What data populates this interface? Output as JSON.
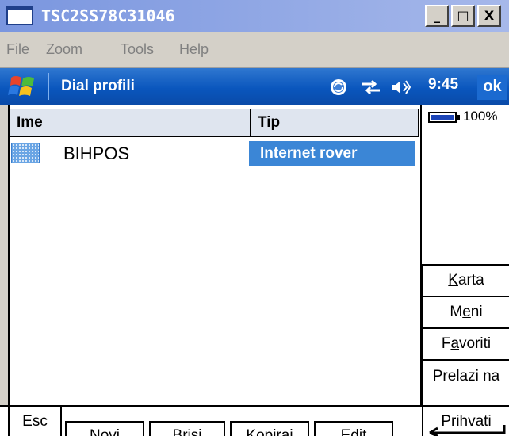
{
  "window": {
    "title": "TSC2SS78C31046",
    "controls": {
      "minimize": "_",
      "maximize": "□",
      "close": "X"
    }
  },
  "menubar": {
    "items": [
      {
        "first": "F",
        "rest": "ile"
      },
      {
        "first": "Z",
        "rest": "oom"
      },
      {
        "first": "T",
        "rest": "ools"
      },
      {
        "first": "H",
        "rest": "elp"
      }
    ]
  },
  "device_titlebar": {
    "title": "Dial profili",
    "time": "9:45",
    "ok_label": "ok",
    "icons": [
      "windows-start-icon",
      "sync-icon",
      "connectivity-icon",
      "speaker-icon"
    ]
  },
  "list": {
    "columns": [
      "Ime",
      "Tip"
    ],
    "rows": [
      {
        "name": "BIHPOS",
        "type": "Internet rover",
        "selected": true
      }
    ]
  },
  "status": {
    "battery_percent": "100%",
    "battery_level": 1.0
  },
  "side_menu": [
    {
      "pre": "",
      "ul": "K",
      "post": "arta"
    },
    {
      "pre": "M",
      "ul": "e",
      "post": "ni"
    },
    {
      "pre": "F",
      "ul": "a",
      "post": "voriti"
    },
    {
      "pre": "Prelazi na",
      "ul": "",
      "post": ""
    }
  ],
  "commands": {
    "esc": "Esc",
    "buttons": [
      "Novi",
      "Brisi",
      "Kopiraj",
      "Edit"
    ],
    "accept": "Prihvati"
  },
  "colors": {
    "selection": "#3b86d6",
    "device_titlebar": "#0a56bd",
    "list_header": "#dfe5ef"
  }
}
